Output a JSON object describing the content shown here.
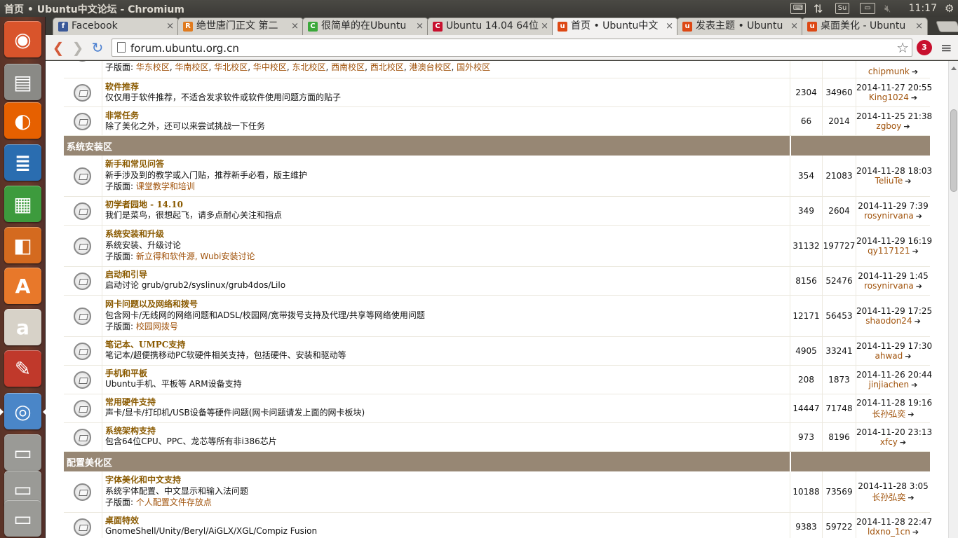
{
  "window_title": "首页 • Ubuntu中文论坛 - Chromium",
  "clock": "11:17",
  "tray": {
    "user_indicator": "Su"
  },
  "tabs": [
    {
      "label": "Facebook",
      "favicon": "f",
      "color": "#3b5998"
    },
    {
      "label": "绝世唐门正文 第二",
      "favicon": "R",
      "color": "#e07b1f"
    },
    {
      "label": "很简单的在Ubuntu",
      "favicon": "C",
      "color": "#3aa83a"
    },
    {
      "label": "Ubuntu 14.04 64位",
      "favicon": "C",
      "color": "#c8102e"
    },
    {
      "label": "首页 • Ubuntu中文",
      "favicon": "u",
      "color": "#dd4814",
      "active": true
    },
    {
      "label": "发表主题 • Ubuntu",
      "favicon": "u",
      "color": "#dd4814"
    },
    {
      "label": "桌面美化 - Ubuntu",
      "favicon": "u",
      "color": "#dd4814"
    }
  ],
  "toolbar": {
    "url": "forum.ubuntu.org.cn",
    "extension_badge": "3"
  },
  "launcher": [
    {
      "name": "ubuntu-dash-icon",
      "glyph": "◉",
      "bg": "#d9542b"
    },
    {
      "name": "files-icon",
      "glyph": "▤",
      "bg": "#8a8a86"
    },
    {
      "name": "firefox-icon",
      "glyph": "◐",
      "bg": "#e66000"
    },
    {
      "name": "writer-icon",
      "glyph": "≣",
      "bg": "#2a6db0"
    },
    {
      "name": "calc-icon",
      "glyph": "▦",
      "bg": "#3d9b3d"
    },
    {
      "name": "impress-icon",
      "glyph": "◧",
      "bg": "#d46a1f"
    },
    {
      "name": "software-center-icon",
      "glyph": "A",
      "bg": "#e8782a"
    },
    {
      "name": "amazon-icon",
      "glyph": "a",
      "bg": "#d7d2c8"
    },
    {
      "name": "system-settings-icon",
      "glyph": "✎",
      "bg": "#c0392b"
    },
    {
      "name": "chromium-icon",
      "glyph": "◎",
      "bg": "#4a86c8",
      "active": true
    },
    {
      "name": "drive-icon",
      "glyph": "▭",
      "bg": "#9a9a96"
    },
    {
      "name": "drive-icon-2",
      "glyph": "▭",
      "bg": "#9a9a96"
    },
    {
      "name": "drive-icon-3",
      "glyph": "▭",
      "bg": "#9a9a96"
    }
  ],
  "forum": {
    "top_row": {
      "sub_label": "子版面:",
      "subforums": [
        "华东校区",
        "华南校区",
        "华北校区",
        "华中校区",
        "东北校区",
        "西南校区",
        "西北校区",
        "港澳台校区",
        "国外校区"
      ],
      "last_user": "chipmunk"
    },
    "rows_a": [
      {
        "title": "软件推荐",
        "desc": "仅仅用于软件推荐，不适合发求软件或软件使用问题方面的贴子",
        "topics": "2304",
        "posts": "34960",
        "date": "2014-11-27 20:55",
        "user": "King1024"
      },
      {
        "title": "非常任务",
        "desc": "除了美化之外，还可以来尝试挑战一下任务",
        "topics": "66",
        "posts": "2014",
        "date": "2014-11-25 21:38",
        "user": "zgboy"
      }
    ],
    "category_1": "系统安装区",
    "rows_b": [
      {
        "title": "新手和常见问答",
        "desc": "新手涉及到的教学或入门贴，推荐新手必看，版主维护",
        "sub_label": "子版面:",
        "sub": "课堂教学和培训",
        "topics": "354",
        "posts": "21083",
        "date": "2014-11-28 18:03",
        "user": "TeliuTe"
      },
      {
        "title": "初学者园地 - 14.10",
        "desc": "我们是菜鸟，很想起飞，请多点耐心关注和指点",
        "topics": "349",
        "posts": "2604",
        "date": "2014-11-29 7:39",
        "user": "rosynirvana"
      },
      {
        "title": "系统安装和升级",
        "desc": "系统安装、升级讨论",
        "sub_label": "子版面:",
        "sub": "新立得和软件源, Wubi安装讨论",
        "topics": "31132",
        "posts": "197727",
        "date": "2014-11-29 16:19",
        "user": "qy117121"
      },
      {
        "title": "启动和引导",
        "desc": "启动讨论 grub/grub2/syslinux/grub4dos/Lilo",
        "topics": "8156",
        "posts": "52476",
        "date": "2014-11-29 1:45",
        "user": "rosynirvana"
      },
      {
        "title": "网卡问题以及网络和拨号",
        "desc": "包含网卡/无线网的网络问题和ADSL/校园网/宽带拨号支持及代理/共享等网络使用问题",
        "sub_label": "子版面:",
        "sub": "校园网拨号",
        "topics": "12171",
        "posts": "56453",
        "date": "2014-11-29 17:25",
        "user": "shaodon24"
      },
      {
        "title": "笔记本、UMPC支持",
        "desc": "笔记本/超便携移动PC软硬件相关支持，包括硬件、安装和驱动等",
        "topics": "4905",
        "posts": "33241",
        "date": "2014-11-29 17:30",
        "user": "ahwad"
      },
      {
        "title": "手机和平板",
        "desc": "Ubuntu手机、平板等 ARM设备支持",
        "topics": "208",
        "posts": "1873",
        "date": "2014-11-26 20:44",
        "user": "jinjiachen"
      },
      {
        "title": "常用硬件支持",
        "desc": "声卡/显卡/打印机/USB设备等硬件问题(网卡问题请发上面的网卡板块)",
        "topics": "14447",
        "posts": "71748",
        "date": "2014-11-28 19:16",
        "user": "长孙弘奕"
      },
      {
        "title": "系统架构支持",
        "desc": "包含64位CPU、PPC、龙芯等所有非i386芯片",
        "topics": "973",
        "posts": "8196",
        "date": "2014-11-20 23:13",
        "user": "xfcy"
      }
    ],
    "category_2": "配置美化区",
    "rows_c": [
      {
        "title": "字体美化和中文支持",
        "desc": "系统字体配置、中文显示和输入法问题",
        "sub_label": "子版面:",
        "sub": "个人配置文件存放点",
        "topics": "10188",
        "posts": "73569",
        "date": "2014-11-28 3:05",
        "user": "长孙弘奕"
      },
      {
        "title": "桌面特效",
        "desc": "GnomeShell/Unity/Beryl/AiGLX/XGL/Compiz Fusion",
        "topics": "9383",
        "posts": "59722",
        "date": "2014-11-28 22:47",
        "user": "ldxno_1cn"
      }
    ]
  }
}
